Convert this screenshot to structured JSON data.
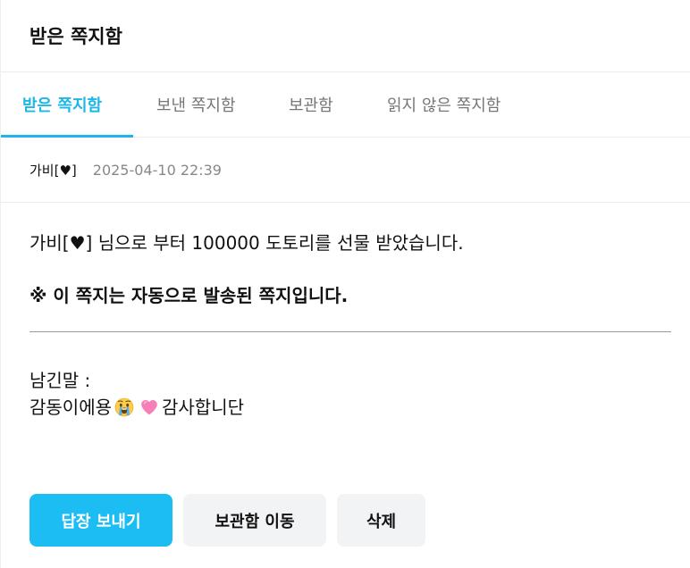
{
  "header": {
    "title": "받은 쪽지함"
  },
  "tabs": [
    {
      "label": "받은 쪽지함",
      "active": true
    },
    {
      "label": "보낸 쪽지함",
      "active": false
    },
    {
      "label": "보관함",
      "active": false
    },
    {
      "label": "읽지 않은 쪽지함",
      "active": false
    }
  ],
  "message": {
    "sender": "가비[♥]",
    "date": "2025-04-10 22:39",
    "body": "가비[♥] 님으로 부터 100000 도토리를 선물 받았습니다.",
    "notice": "※ 이 쪽지는 자동으로 발송된 쪽지입니다.",
    "memo_label": "남긴말 :",
    "memo_text_before": "감동이에용",
    "memo_text_after": "감사합니단",
    "emojis": [
      "crying-face-emoji",
      "pink-heart-emoji"
    ]
  },
  "actions": {
    "reply_label": "답장 보내기",
    "archive_label": "보관함 이동",
    "delete_label": "삭제"
  },
  "colors": {
    "accent": "#1cb7e8",
    "primary_button": "#1cbdf2",
    "secondary_button": "#f2f3f5"
  }
}
